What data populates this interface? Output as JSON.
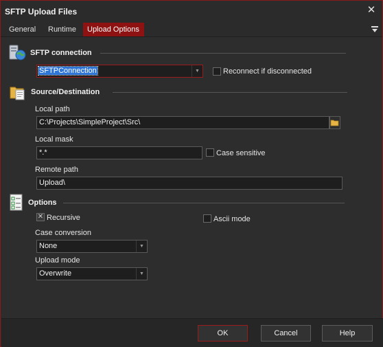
{
  "window": {
    "title": "SFTP Upload Files"
  },
  "tabs": [
    {
      "label": "General"
    },
    {
      "label": "Runtime"
    },
    {
      "label": "Upload Options"
    }
  ],
  "sftp_section": {
    "title": "SFTP connection",
    "connection_value": "SFTPConnection",
    "reconnect_label": "Reconnect if disconnected",
    "reconnect_checked": false
  },
  "source_section": {
    "title": "Source/Destination",
    "local_path_label": "Local path",
    "local_path_value": "C:\\Projects\\SimpleProject\\Src\\",
    "local_mask_label": "Local mask",
    "local_mask_value": "*.*",
    "case_sensitive_label": "Case sensitive",
    "case_sensitive_checked": false,
    "remote_path_label": "Remote path",
    "remote_path_value": "Upload\\"
  },
  "options_section": {
    "title": "Options",
    "recursive_label": "Recursive",
    "recursive_checked": true,
    "ascii_mode_label": "Ascii mode",
    "ascii_mode_checked": false,
    "case_conversion_label": "Case conversion",
    "case_conversion_value": "None",
    "upload_mode_label": "Upload mode",
    "upload_mode_value": "Overwrite"
  },
  "footer": {
    "ok_label": "OK",
    "cancel_label": "Cancel",
    "help_label": "Help"
  },
  "colors": {
    "accent": "#8f1212",
    "background": "#2d2d2d",
    "field_bg": "#1e1e1e",
    "selection": "#2f76d6"
  },
  "icons": {
    "sftp": "server-globe-icon",
    "source": "folder-files-icon",
    "options": "checklist-icon",
    "browse": "folder-icon"
  }
}
